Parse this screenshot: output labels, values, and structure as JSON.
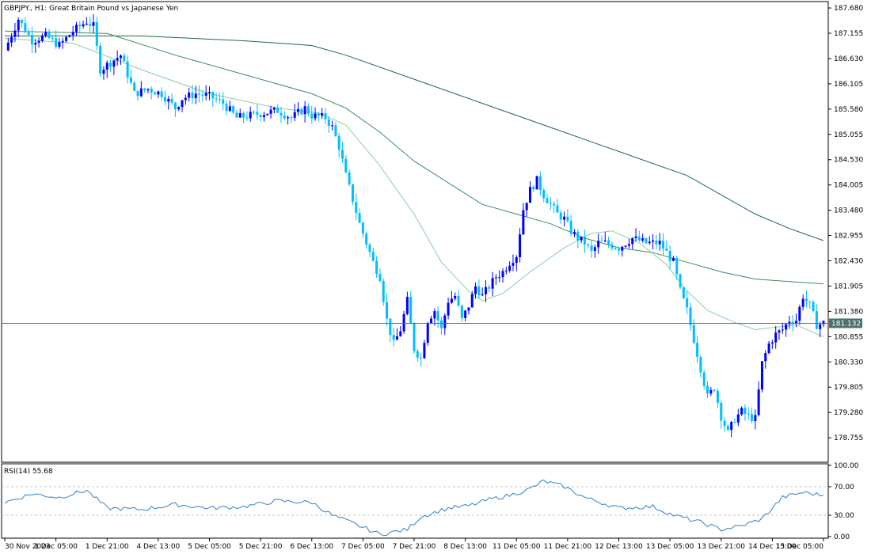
{
  "chart_data": [
    {
      "type": "candlestick",
      "title": "GBPJPY., H1:  Great Britain Pound vs Japanese Yen",
      "symbol": "GBPJPY.",
      "timeframe": "H1",
      "description": "Great Britain Pound vs Japanese Yen",
      "ylim": [
        178.28,
        187.78
      ],
      "y_ticks": [
        "187.680",
        "187.155",
        "186.630",
        "186.105",
        "185.580",
        "185.055",
        "184.530",
        "184.005",
        "183.480",
        "182.955",
        "182.430",
        "181.905",
        "181.380",
        "180.855",
        "180.330",
        "179.805",
        "179.280",
        "178.755"
      ],
      "x_ticks": [
        "30 Nov 2023",
        "1 Dec 05:00",
        "1 Dec 21:00",
        "4 Dec 13:00",
        "5 Dec 05:00",
        "5 Dec 21:00",
        "6 Dec 13:00",
        "7 Dec 05:00",
        "7 Dec 21:00",
        "8 Dec 13:00",
        "11 Dec 05:00",
        "11 Dec 21:00",
        "12 Dec 13:00",
        "13 Dec 05:00",
        "13 Dec 21:00",
        "14 Dec 13:00",
        "15 Dec 05:00"
      ],
      "current_price": "181.132",
      "current_price_value": 181.132,
      "close_path": [
        [
          0,
          186.8
        ],
        [
          4,
          187.45
        ],
        [
          8,
          187.0
        ],
        [
          12,
          187.1
        ],
        [
          16,
          186.9
        ],
        [
          20,
          187.2
        ],
        [
          24,
          187.4
        ],
        [
          26,
          187.3
        ],
        [
          28,
          186.4
        ],
        [
          34,
          186.7
        ],
        [
          38,
          185.9
        ],
        [
          42,
          186.0
        ],
        [
          46,
          185.9
        ],
        [
          50,
          185.6
        ],
        [
          52,
          185.8
        ],
        [
          56,
          185.9
        ],
        [
          60,
          185.85
        ],
        [
          64,
          185.7
        ],
        [
          68,
          185.4
        ],
        [
          72,
          185.45
        ],
        [
          76,
          185.5
        ],
        [
          80,
          185.55
        ],
        [
          84,
          185.4
        ],
        [
          88,
          185.6
        ],
        [
          90,
          185.45
        ],
        [
          94,
          185.4
        ],
        [
          96,
          185.2
        ],
        [
          98,
          184.8
        ],
        [
          100,
          184.2
        ],
        [
          104,
          183.2
        ],
        [
          108,
          182.4
        ],
        [
          110,
          182.1
        ],
        [
          112,
          181.2
        ],
        [
          114,
          180.7
        ],
        [
          116,
          181.0
        ],
        [
          118,
          181.6
        ],
        [
          120,
          180.6
        ],
        [
          122,
          180.4
        ],
        [
          124,
          181.2
        ],
        [
          126,
          181.4
        ],
        [
          128,
          181.0
        ],
        [
          130,
          181.6
        ],
        [
          132,
          181.7
        ],
        [
          134,
          181.2
        ],
        [
          136,
          181.5
        ],
        [
          138,
          181.9
        ],
        [
          140,
          181.7
        ],
        [
          142,
          181.9
        ],
        [
          144,
          182.1
        ],
        [
          146,
          182.2
        ],
        [
          148,
          182.4
        ],
        [
          150,
          182.55
        ],
        [
          152,
          183.5
        ],
        [
          154,
          183.9
        ],
        [
          156,
          184.1
        ],
        [
          158,
          183.8
        ],
        [
          160,
          183.6
        ],
        [
          162,
          183.4
        ],
        [
          164,
          183.3
        ],
        [
          166,
          183.05
        ],
        [
          168,
          182.9
        ],
        [
          170,
          182.8
        ],
        [
          172,
          182.6
        ],
        [
          174,
          182.8
        ],
        [
          176,
          182.8
        ],
        [
          180,
          182.7
        ],
        [
          184,
          182.9
        ],
        [
          188,
          182.8
        ],
        [
          192,
          182.8
        ],
        [
          194,
          182.6
        ],
        [
          196,
          182.4
        ],
        [
          198,
          181.8
        ],
        [
          200,
          181.4
        ],
        [
          202,
          180.8
        ],
        [
          204,
          180.2
        ],
        [
          206,
          179.6
        ],
        [
          208,
          179.8
        ],
        [
          210,
          179.2
        ],
        [
          212,
          178.85
        ],
        [
          214,
          179.15
        ],
        [
          216,
          179.3
        ],
        [
          218,
          179.2
        ],
        [
          220,
          179.15
        ],
        [
          222,
          180.3
        ],
        [
          224,
          180.7
        ],
        [
          226,
          180.9
        ],
        [
          228,
          181.0
        ],
        [
          230,
          181.2
        ],
        [
          232,
          181.2
        ],
        [
          234,
          181.7
        ],
        [
          236,
          181.5
        ],
        [
          238,
          181.1
        ],
        [
          240,
          181.132
        ]
      ],
      "series": [
        {
          "type": "ma",
          "color": "#1e6b3c",
          "path": [
            [
              0,
              187.1
            ],
            [
              40,
              187.1
            ],
            [
              70,
              187.0
            ],
            [
              90,
              186.9
            ],
            [
              100,
              186.7
            ],
            [
              120,
              186.2
            ],
            [
              140,
              185.7
            ],
            [
              160,
              185.2
            ],
            [
              180,
              184.7
            ],
            [
              200,
              184.2
            ],
            [
              210,
              183.8
            ],
            [
              220,
              183.4
            ],
            [
              230,
              183.1
            ],
            [
              240,
              182.85
            ]
          ]
        },
        {
          "type": "ma",
          "color": "#3f8c58",
          "path": [
            [
              0,
              187.2
            ],
            [
              30,
              187.15
            ],
            [
              50,
              186.7
            ],
            [
              70,
              186.3
            ],
            [
              90,
              185.9
            ],
            [
              100,
              185.6
            ],
            [
              110,
              185.1
            ],
            [
              120,
              184.5
            ],
            [
              140,
              183.6
            ],
            [
              150,
              183.4
            ],
            [
              160,
              183.2
            ],
            [
              170,
              182.9
            ],
            [
              180,
              182.7
            ],
            [
              190,
              182.6
            ],
            [
              200,
              182.4
            ],
            [
              210,
              182.2
            ],
            [
              220,
              182.05
            ],
            [
              230,
              182.0
            ],
            [
              240,
              181.95
            ]
          ]
        },
        {
          "type": "ma",
          "color": "#8ccf9e",
          "path": [
            [
              0,
              187.05
            ],
            [
              20,
              186.95
            ],
            [
              40,
              186.4
            ],
            [
              60,
              185.9
            ],
            [
              80,
              185.6
            ],
            [
              92,
              185.5
            ],
            [
              100,
              185.25
            ],
            [
              110,
              184.4
            ],
            [
              120,
              183.4
            ],
            [
              128,
              182.4
            ],
            [
              136,
              181.8
            ],
            [
              140,
              181.6
            ],
            [
              146,
              181.75
            ],
            [
              154,
              182.2
            ],
            [
              164,
              182.7
            ],
            [
              172,
              183.0
            ],
            [
              178,
              183.05
            ],
            [
              186,
              182.8
            ],
            [
              194,
              182.35
            ],
            [
              200,
              181.8
            ],
            [
              206,
              181.4
            ],
            [
              214,
              181.15
            ],
            [
              220,
              181.0
            ],
            [
              232,
              181.1
            ],
            [
              240,
              180.85
            ]
          ]
        }
      ]
    },
    {
      "type": "line",
      "title": "RSI(14) 55.68",
      "indicator": "RSI",
      "period": 14,
      "value": 55.68,
      "ylim": [
        0,
        100
      ],
      "y_ticks": [
        "100.00",
        "70.00",
        "30.00",
        "0.00"
      ],
      "levels": [
        70,
        30
      ],
      "color": "#2f80c9",
      "path": [
        [
          0,
          48
        ],
        [
          8,
          60
        ],
        [
          16,
          55
        ],
        [
          24,
          65
        ],
        [
          30,
          40
        ],
        [
          40,
          38
        ],
        [
          50,
          45
        ],
        [
          60,
          40
        ],
        [
          70,
          42
        ],
        [
          80,
          50
        ],
        [
          90,
          48
        ],
        [
          96,
          30
        ],
        [
          104,
          15
        ],
        [
          110,
          3
        ],
        [
          118,
          10
        ],
        [
          122,
          28
        ],
        [
          130,
          40
        ],
        [
          136,
          43
        ],
        [
          142,
          52
        ],
        [
          148,
          58
        ],
        [
          154,
          67
        ],
        [
          158,
          78
        ],
        [
          164,
          70
        ],
        [
          170,
          55
        ],
        [
          180,
          40
        ],
        [
          190,
          42
        ],
        [
          196,
          30
        ],
        [
          204,
          20
        ],
        [
          210,
          10
        ],
        [
          216,
          15
        ],
        [
          222,
          25
        ],
        [
          228,
          55
        ],
        [
          234,
          62
        ],
        [
          240,
          58
        ]
      ]
    }
  ]
}
